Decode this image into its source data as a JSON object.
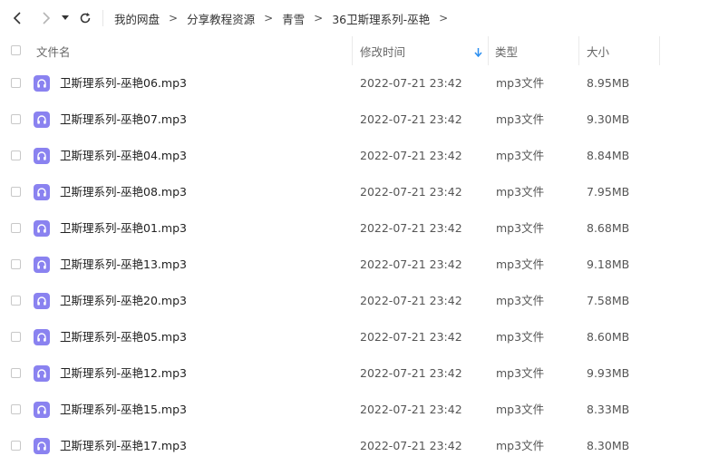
{
  "toolbar": {
    "back_icon": "chevron-left-icon",
    "forward_icon": "chevron-right-icon",
    "history_icon": "caret-down-icon",
    "refresh_icon": "refresh-icon"
  },
  "breadcrumb": {
    "items": [
      "我的网盘",
      "分享教程资源",
      "青雪",
      "36卫斯理系列-巫艳"
    ],
    "separator": ">"
  },
  "columns": {
    "name": "文件名",
    "modified": "修改时间",
    "type": "类型",
    "size": "大小",
    "sort_icon": "arrow-down-icon",
    "sort_color": "#2b8ff0"
  },
  "files": [
    {
      "name": "卫斯理系列-巫艳06.mp3",
      "modified": "2022-07-21 23:42",
      "type": "mp3文件",
      "size": "8.95MB"
    },
    {
      "name": "卫斯理系列-巫艳07.mp3",
      "modified": "2022-07-21 23:42",
      "type": "mp3文件",
      "size": "9.30MB"
    },
    {
      "name": "卫斯理系列-巫艳04.mp3",
      "modified": "2022-07-21 23:42",
      "type": "mp3文件",
      "size": "8.84MB"
    },
    {
      "name": "卫斯理系列-巫艳08.mp3",
      "modified": "2022-07-21 23:42",
      "type": "mp3文件",
      "size": "7.95MB"
    },
    {
      "name": "卫斯理系列-巫艳01.mp3",
      "modified": "2022-07-21 23:42",
      "type": "mp3文件",
      "size": "8.68MB"
    },
    {
      "name": "卫斯理系列-巫艳13.mp3",
      "modified": "2022-07-21 23:42",
      "type": "mp3文件",
      "size": "9.18MB"
    },
    {
      "name": "卫斯理系列-巫艳20.mp3",
      "modified": "2022-07-21 23:42",
      "type": "mp3文件",
      "size": "7.58MB"
    },
    {
      "name": "卫斯理系列-巫艳05.mp3",
      "modified": "2022-07-21 23:42",
      "type": "mp3文件",
      "size": "8.60MB"
    },
    {
      "name": "卫斯理系列-巫艳12.mp3",
      "modified": "2022-07-21 23:42",
      "type": "mp3文件",
      "size": "9.93MB"
    },
    {
      "name": "卫斯理系列-巫艳15.mp3",
      "modified": "2022-07-21 23:42",
      "type": "mp3文件",
      "size": "8.33MB"
    },
    {
      "name": "卫斯理系列-巫艳17.mp3",
      "modified": "2022-07-21 23:42",
      "type": "mp3文件",
      "size": "8.30MB"
    }
  ],
  "file_icon": "headphones-icon",
  "file_icon_color": "#8a82f0"
}
